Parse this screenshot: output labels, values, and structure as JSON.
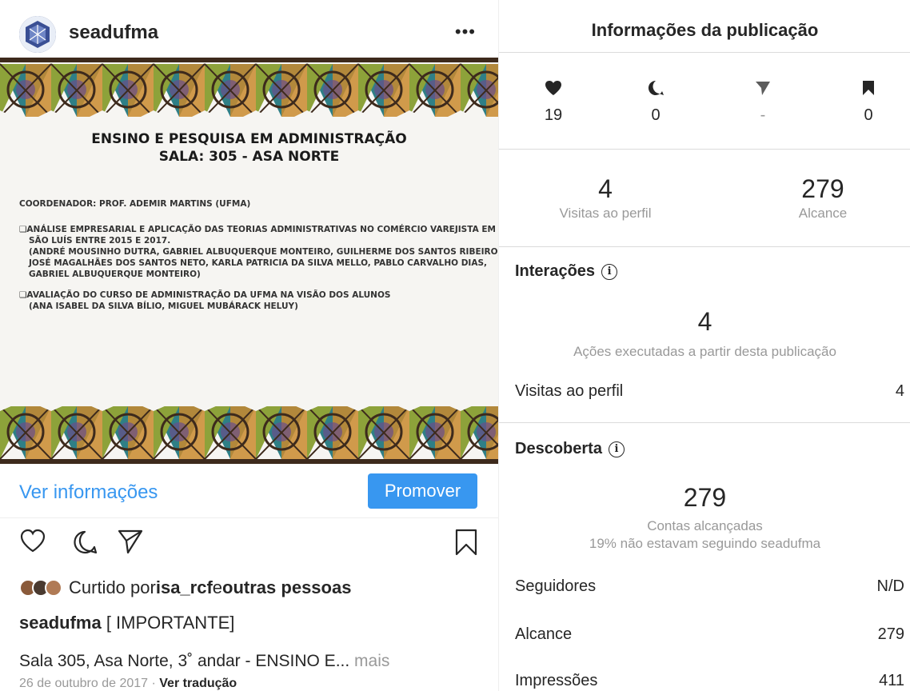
{
  "post": {
    "username": "seadufma",
    "more": "•••",
    "image": {
      "title_line1": "ENSINO E PESQUISA EM ADMINISTRAÇÃO",
      "title_line2": "SALA: 305 - ASA NORTE",
      "coordinator": "COORDENADOR: PROF. ADEMIR MARTINS (UFMA)",
      "item1_line1": "❑ANÁLISE EMPRESARIAL E APLICAÇÃO DAS TEORIAS ADMINISTRATIVAS NO COMÉRCIO VAREJISTA EM",
      "item1_line2": "SÃO LUÍS ENTRE 2015 E 2017.",
      "item1_line3": "(ANDRÉ MOUSINHO DUTRA, GABRIEL ALBUQUERQUE MONTEIRO, GUILHERME DOS SANTOS RIBEIRO,",
      "item1_line4": "JOSÉ MAGALHÃES DOS SANTOS NETO, KARLA PATRICIA DA SILVA MELLO, PABLO CARVALHO DIAS,",
      "item1_line5": "GABRIEL ALBUQUERQUE MONTEIRO)",
      "item2_line1": "❑AVALIAÇÃO DO CURSO DE ADMINISTRAÇÃO DA UFMA NA VISÃO DOS ALUNOS",
      "item2_line2": "(ANA ISABEL DA SILVA BÍLIO, MIGUEL MUBÁRACK HELUY)"
    },
    "see_info": "Ver informações",
    "promote": "Promover",
    "liked_prefix": "Curtido por ",
    "liked_user": "isa_rcf",
    "liked_mid": " e ",
    "liked_others": "outras pessoas",
    "caption_user": "seadufma",
    "caption_text": " [ IMPORTANTE]",
    "caption2_text": "Sala 305, Asa Norte, 3˚ andar - ENSINO E... ",
    "caption2_more": "mais",
    "date": "26 de outubro de 2017 · ",
    "translate": "Ver tradução"
  },
  "insights": {
    "title": "Informações da publicação",
    "metrics": {
      "likes": "19",
      "comments": "0",
      "shares": "-",
      "saves": "0"
    },
    "profile_visits_num": "4",
    "profile_visits_label": "Visitas ao perfil",
    "reach_num": "279",
    "reach_label": "Alcance",
    "interactions": {
      "title": "Interações",
      "num": "4",
      "sub": "Ações executadas a partir desta publicação",
      "row_label": "Visitas ao perfil",
      "row_value": "4"
    },
    "discovery": {
      "title": "Descoberta",
      "num": "279",
      "sub1": "Contas alcançadas",
      "sub2": "19% não estavam seguindo seadufma",
      "rows": [
        {
          "label": "Seguidores",
          "value": "N/D"
        },
        {
          "label": "Alcance",
          "value": "279"
        },
        {
          "label": "Impressões",
          "value": "411"
        }
      ]
    },
    "info_glyph": "i"
  },
  "colors": {
    "accent": "#3897f0",
    "text": "#262626",
    "muted": "#999999",
    "divider": "#dbdbdb"
  }
}
